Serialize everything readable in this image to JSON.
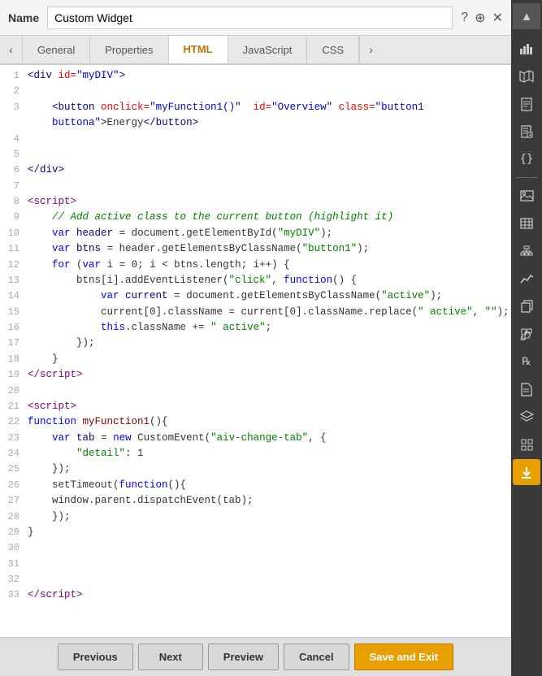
{
  "header": {
    "label": "Name",
    "input_value": "Custom Widget",
    "icons": [
      "?",
      "⊕",
      "✕",
      "▲"
    ]
  },
  "tabs": {
    "left_arrow": "‹",
    "right_arrow": "›",
    "items": [
      {
        "label": "General",
        "active": false
      },
      {
        "label": "Properties",
        "active": false
      },
      {
        "label": "HTML",
        "active": true
      },
      {
        "label": "JavaScript",
        "active": false
      },
      {
        "label": "CSS",
        "active": false
      }
    ]
  },
  "footer": {
    "previous_label": "Previous",
    "next_label": "Next",
    "preview_label": "Preview",
    "cancel_label": "Cancel",
    "save_exit_label": "Save and Exit"
  },
  "sidebar": {
    "icons": [
      {
        "name": "up-arrow-icon",
        "symbol": "▲"
      },
      {
        "name": "bar-chart-icon",
        "symbol": "📊"
      },
      {
        "name": "map-icon",
        "symbol": "🗺"
      },
      {
        "name": "document-icon",
        "symbol": "📄"
      },
      {
        "name": "notes-icon",
        "symbol": "📝"
      },
      {
        "name": "code-braces-icon",
        "symbol": "{}"
      },
      {
        "name": "image-icon",
        "symbol": "🖼"
      },
      {
        "name": "table-icon",
        "symbol": "⊞"
      },
      {
        "name": "hierarchy-icon",
        "symbol": "⛶"
      },
      {
        "name": "analytics-icon",
        "symbol": "📈"
      },
      {
        "name": "copy-icon",
        "symbol": "⎘"
      },
      {
        "name": "puzzle-icon",
        "symbol": "🧩"
      },
      {
        "name": "rx-icon",
        "symbol": "℞"
      },
      {
        "name": "file-icon",
        "symbol": "🗒"
      },
      {
        "name": "layers-icon",
        "symbol": "⊕"
      },
      {
        "name": "grid-icon",
        "symbol": "⊞"
      },
      {
        "name": "download-icon",
        "symbol": "⬇"
      }
    ]
  }
}
